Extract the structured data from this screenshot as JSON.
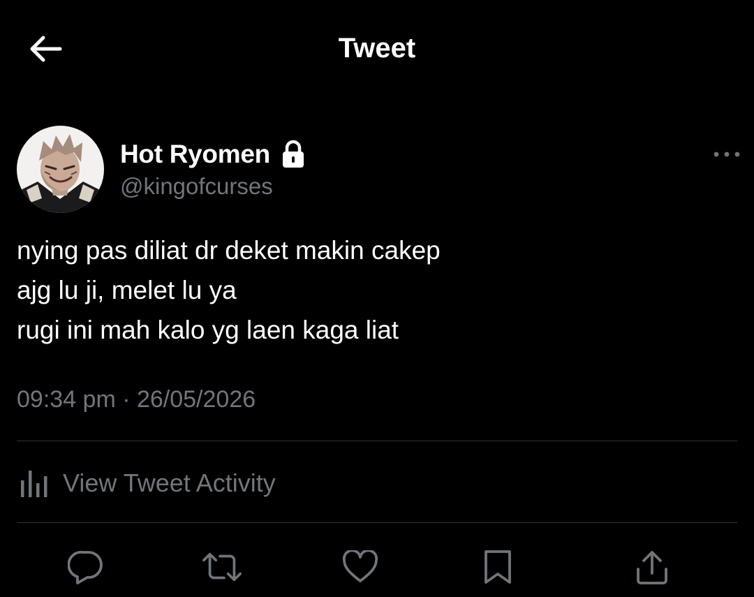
{
  "header": {
    "title": "Tweet",
    "back_icon": "back-arrow-icon"
  },
  "author": {
    "display_name": "Hot Ryomen",
    "handle": "@kingofcurses",
    "protected_icon": "lock-icon",
    "avatar_icon": "avatar-image"
  },
  "menu": {
    "icon": "more-dots-icon"
  },
  "tweet": {
    "lines": [
      "nying pas diliat dr deket makin cakep",
      "ajg lu ji, melet lu ya",
      "rugi ini mah kalo yg laen kaga liat"
    ],
    "timestamp": "09:34 pm · 26/05/2026"
  },
  "activity": {
    "label": "View Tweet Activity",
    "icon": "analytics-bars-icon"
  },
  "actions": [
    {
      "name": "reply",
      "icon": "reply-bubble-icon"
    },
    {
      "name": "retweet",
      "icon": "retweet-icon"
    },
    {
      "name": "like",
      "icon": "heart-icon"
    },
    {
      "name": "bookmark",
      "icon": "bookmark-icon"
    },
    {
      "name": "share",
      "icon": "share-icon"
    }
  ],
  "colors": {
    "background": "#000000",
    "primary_text": "#ffffff",
    "secondary_text": "#71767b",
    "divider": "#2f3336"
  }
}
